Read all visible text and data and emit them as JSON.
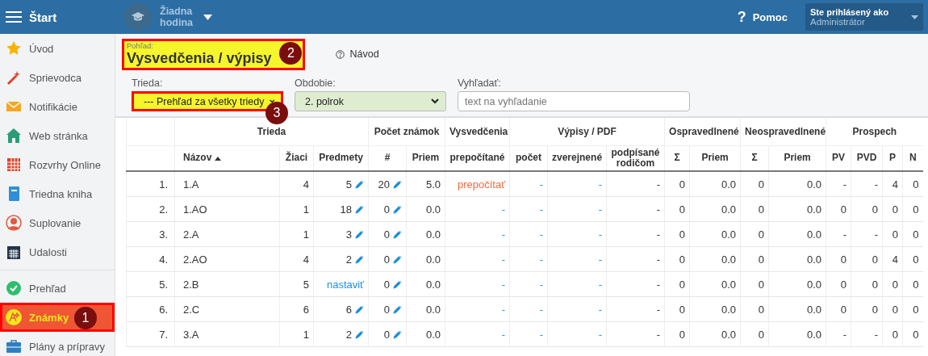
{
  "header": {
    "title": "Štart",
    "lesson": "Žiadna hodina",
    "help_icon": "?",
    "help": "Pomoc",
    "user_caption": "Ste prihlásený ako",
    "user_name": "Administrátor"
  },
  "sidebar": {
    "sections": [
      [
        {
          "label": "Úvod",
          "selected": false
        },
        {
          "label": "Sprievodca",
          "selected": false
        },
        {
          "label": "Notifikácie",
          "selected": false
        },
        {
          "label": "Web stránka",
          "selected": false
        },
        {
          "label": "Rozvrhy Online",
          "selected": false
        },
        {
          "label": "Triedna kniha",
          "selected": false
        },
        {
          "label": "Suplovanie",
          "selected": false
        },
        {
          "label": "Udalosti",
          "selected": false
        }
      ],
      [
        {
          "label": "Prehľad",
          "selected": false
        },
        {
          "label": "Známky",
          "selected": true,
          "highlighted": true,
          "badge": "1"
        },
        {
          "label": "Plány a prípravy",
          "selected": false
        }
      ]
    ]
  },
  "view": {
    "caption": "Pohľad:",
    "title": "Vysvedčenia / výpisy",
    "highlighted": true,
    "badge": "2",
    "guide": "Návod"
  },
  "filters": [
    {
      "kind": "select",
      "label": "Trieda:",
      "value": "--- Prehľad za všetky triedy",
      "highlighted": true,
      "badge": "3"
    },
    {
      "kind": "select",
      "label": "Obdobie:",
      "value": "2. polrok",
      "tinted": true
    },
    {
      "kind": "search",
      "label": "Vyhľadať:",
      "placeholder": "text na vyhľadanie"
    }
  ],
  "table": {
    "groups": [
      {
        "label": "Trieda",
        "columns": [
          {
            "label": "Názov",
            "sorted": true
          },
          {
            "label": "Žiaci"
          },
          {
            "label": "Predmety"
          }
        ]
      },
      {
        "label": "Počet známok",
        "columns": [
          {
            "label": "#"
          },
          {
            "label": "Priem"
          }
        ]
      },
      {
        "label": "Vysvedčenia",
        "columns": [
          {
            "label": "prepočítané"
          }
        ]
      },
      {
        "label": "Výpisy / PDF",
        "columns": [
          {
            "label": "počet"
          },
          {
            "label": "zverejnené"
          },
          {
            "label": "podpísané rodičom"
          }
        ]
      },
      {
        "label": "Ospravedlnené",
        "columns": [
          {
            "label": "Σ"
          },
          {
            "label": "Priem"
          }
        ]
      },
      {
        "label": "Neospravedlnené",
        "columns": [
          {
            "label": "Σ"
          },
          {
            "label": "Priem"
          }
        ]
      },
      {
        "label": "Prospech",
        "columns": [
          {
            "label": "PV"
          },
          {
            "label": "PVD"
          },
          {
            "label": "P"
          },
          {
            "label": "N"
          }
        ]
      }
    ],
    "rows": [
      {
        "number": "1.",
        "cells": [
          "1.A",
          "4",
          {
            "text": "5",
            "kind": "edit"
          },
          {
            "text": "20",
            "kind": "edit"
          },
          "5.0",
          {
            "text": "prepočítať",
            "kind": "alert"
          },
          {
            "text": "-",
            "kind": "link"
          },
          {
            "text": "-",
            "kind": "link"
          },
          "-",
          "0",
          "0.0",
          "0",
          "0.0",
          "-",
          "-",
          "4",
          "0"
        ]
      },
      {
        "number": "2.",
        "cells": [
          "1.AO",
          "1",
          {
            "text": "18",
            "kind": "edit"
          },
          {
            "text": "0",
            "kind": "edit"
          },
          "0.0",
          {
            "text": "-",
            "kind": "link"
          },
          {
            "text": "-",
            "kind": "link"
          },
          {
            "text": "-",
            "kind": "link"
          },
          "-",
          "0",
          "0.0",
          "0",
          "0.0",
          "0",
          "0",
          "0",
          "0"
        ]
      },
      {
        "number": "3.",
        "cells": [
          "2.A",
          "1",
          {
            "text": "3",
            "kind": "edit"
          },
          {
            "text": "0",
            "kind": "edit"
          },
          "0.0",
          {
            "text": "-",
            "kind": "link"
          },
          {
            "text": "-",
            "kind": "link"
          },
          {
            "text": "-",
            "kind": "link"
          },
          "-",
          "0",
          "0.0",
          "0",
          "0.0",
          "-",
          "-",
          "0",
          "0"
        ]
      },
      {
        "number": "4.",
        "cells": [
          "2.AO",
          "4",
          {
            "text": "2",
            "kind": "edit"
          },
          {
            "text": "0",
            "kind": "edit"
          },
          "0.0",
          {
            "text": "-",
            "kind": "link"
          },
          {
            "text": "-",
            "kind": "link"
          },
          {
            "text": "-",
            "kind": "link"
          },
          "-",
          "0",
          "0.0",
          "0",
          "0.0",
          "0",
          "0",
          "4",
          "0"
        ]
      },
      {
        "number": "5.",
        "cells": [
          "2.B",
          "5",
          {
            "text": "nastaviť",
            "kind": "link"
          },
          {
            "text": "0",
            "kind": "edit"
          },
          "0.0",
          {
            "text": "-",
            "kind": "link"
          },
          {
            "text": "-",
            "kind": "link"
          },
          {
            "text": "-",
            "kind": "link"
          },
          "-",
          "0",
          "0.0",
          "0",
          "0.0",
          "0",
          "0",
          "0",
          "0"
        ]
      },
      {
        "number": "6.",
        "cells": [
          "2.C",
          "6",
          {
            "text": "6",
            "kind": "edit"
          },
          {
            "text": "0",
            "kind": "edit"
          },
          "0.0",
          {
            "text": "-",
            "kind": "link"
          },
          {
            "text": "-",
            "kind": "link"
          },
          {
            "text": "-",
            "kind": "link"
          },
          "-",
          "0",
          "0.0",
          "0",
          "0.0",
          "0",
          "0",
          "0",
          "0"
        ]
      },
      {
        "number": "7.",
        "cells": [
          "3.A",
          "1",
          {
            "text": "2",
            "kind": "edit"
          },
          {
            "text": "0",
            "kind": "edit"
          },
          "0.0",
          {
            "text": "-",
            "kind": "link"
          },
          {
            "text": "-",
            "kind": "link"
          },
          {
            "text": "-",
            "kind": "link"
          },
          "-",
          "0",
          "0.0",
          "0",
          "0.0",
          "-",
          "-",
          "0",
          "0"
        ]
      }
    ]
  }
}
